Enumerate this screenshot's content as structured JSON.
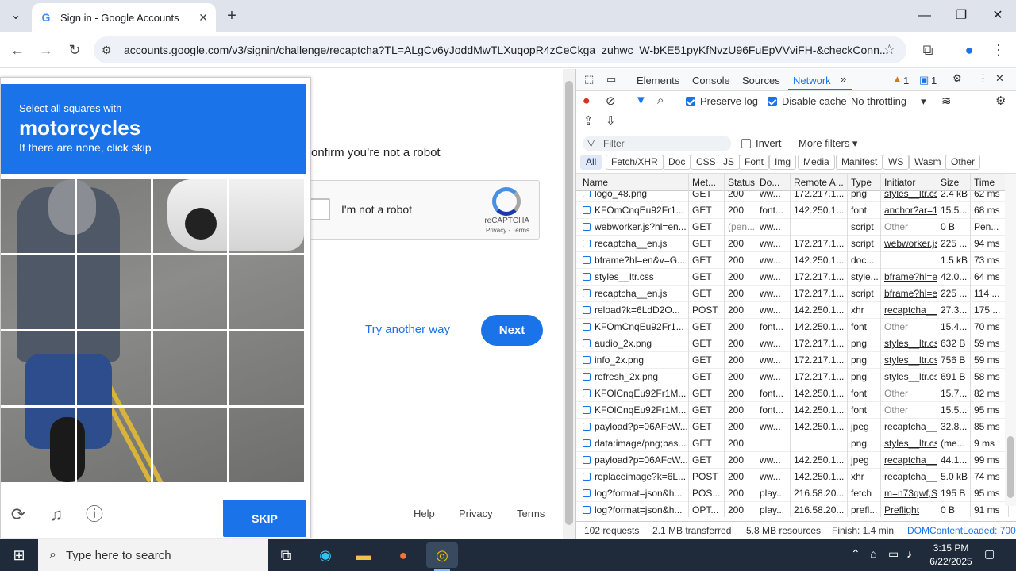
{
  "browser": {
    "tab_title": "Sign in - Google Accounts",
    "tab_favicon": "G",
    "url": "accounts.google.com/v3/signin/challenge/recaptcha?TL=ALgCv6yJoddMwTLXuqopR4zCeCkga_zuhwc_W-bKE51pyKfNvzU96FuEpVVviFH-&checkConn..."
  },
  "captcha": {
    "instruction": "Select all squares with",
    "target": "motorcycles",
    "hint": "If there are none, click skip",
    "skip_label": "SKIP",
    "footer_icons": [
      "reload-icon",
      "audio-icon",
      "info-icon"
    ]
  },
  "signin": {
    "robot_text": "onfirm you’re not a robot",
    "checkbox_label": "I'm not a robot",
    "recaptcha_brand": "reCAPTCHA",
    "privacy_terms": "Privacy - Terms",
    "try_another": "Try another way",
    "next": "Next",
    "footer": {
      "help": "Help",
      "privacy": "Privacy",
      "terms": "Terms"
    }
  },
  "devtools": {
    "tabs": [
      "Elements",
      "Console",
      "Sources",
      "Network"
    ],
    "active_tab": "Network",
    "warnings": "1",
    "messages": "1",
    "preserve_log": "Preserve log",
    "disable_cache": "Disable cache",
    "throttling": "No throttling",
    "filter_placeholder": "Filter",
    "invert": "Invert",
    "more_filters": "More filters",
    "chips": [
      "All",
      "Fetch/XHR",
      "Doc",
      "CSS",
      "JS",
      "Font",
      "Img",
      "Media",
      "Manifest",
      "WS",
      "Wasm",
      "Other"
    ],
    "columns": [
      "Name",
      "Met...",
      "Status",
      "Do...",
      "Remote A...",
      "Type",
      "Initiator",
      "Size",
      "Time"
    ],
    "rows": [
      [
        "logo_48.png",
        "GET",
        "200",
        "ww...",
        "172.217.1...",
        "png",
        "styles__ltr.css",
        "2.4 kB",
        "62 ms"
      ],
      [
        "KFOmCnqEu92Fr1...",
        "GET",
        "200",
        "font...",
        "142.250.1...",
        "font",
        "anchor?ar=1",
        "15.5...",
        "68 ms"
      ],
      [
        "webworker.js?hl=en...",
        "GET",
        "(pen...",
        "ww...",
        "",
        "script",
        "Other",
        "0 B",
        "Pen..."
      ],
      [
        "recaptcha__en.js",
        "GET",
        "200",
        "ww...",
        "172.217.1...",
        "script",
        "webworker.js",
        "225 ...",
        "94 ms"
      ],
      [
        "bframe?hl=en&v=G...",
        "GET",
        "200",
        "ww...",
        "142.250.1...",
        "doc...",
        "",
        "1.5 kB",
        "73 ms"
      ],
      [
        "styles__ltr.css",
        "GET",
        "200",
        "ww...",
        "172.217.1...",
        "style...",
        "bframe?hl=e",
        "42.0...",
        "64 ms"
      ],
      [
        "recaptcha__en.js",
        "GET",
        "200",
        "ww...",
        "172.217.1...",
        "script",
        "bframe?hl=e",
        "225 ...",
        "114 ..."
      ],
      [
        "reload?k=6LdD2O...",
        "POST",
        "200",
        "ww...",
        "142.250.1...",
        "xhr",
        "recaptcha__e",
        "27.3...",
        "175 ..."
      ],
      [
        "KFOmCnqEu92Fr1...",
        "GET",
        "200",
        "font...",
        "142.250.1...",
        "font",
        "Other",
        "15.4...",
        "70 ms"
      ],
      [
        "audio_2x.png",
        "GET",
        "200",
        "ww...",
        "172.217.1...",
        "png",
        "styles__ltr.css",
        "632 B",
        "59 ms"
      ],
      [
        "info_2x.png",
        "GET",
        "200",
        "ww...",
        "172.217.1...",
        "png",
        "styles__ltr.css",
        "756 B",
        "59 ms"
      ],
      [
        "refresh_2x.png",
        "GET",
        "200",
        "ww...",
        "172.217.1...",
        "png",
        "styles__ltr.css",
        "691 B",
        "58 ms"
      ],
      [
        "KFOlCnqEu92Fr1M...",
        "GET",
        "200",
        "font...",
        "142.250.1...",
        "font",
        "Other",
        "15.7...",
        "82 ms"
      ],
      [
        "KFOlCnqEu92Fr1M...",
        "GET",
        "200",
        "font...",
        "142.250.1...",
        "font",
        "Other",
        "15.5...",
        "95 ms"
      ],
      [
        "payload?p=06AFcW...",
        "GET",
        "200",
        "ww...",
        "142.250.1...",
        "jpeg",
        "recaptcha__e",
        "32.8...",
        "85 ms"
      ],
      [
        "data:image/png;bas...",
        "GET",
        "200",
        "",
        "",
        "png",
        "styles__ltr.css",
        "(me...",
        "9 ms"
      ],
      [
        "payload?p=06AFcW...",
        "GET",
        "200",
        "ww...",
        "142.250.1...",
        "jpeg",
        "recaptcha__e",
        "44.1...",
        "99 ms"
      ],
      [
        "replaceimage?k=6L...",
        "POST",
        "200",
        "ww...",
        "142.250.1...",
        "xhr",
        "recaptcha__e",
        "5.0 kB",
        "74 ms"
      ],
      [
        "log?format=json&h...",
        "POS...",
        "200",
        "play...",
        "216.58.20...",
        "fetch",
        "m=n73qwf,S",
        "195 B",
        "95 ms"
      ],
      [
        "log?format=json&h...",
        "OPT...",
        "200",
        "play...",
        "216.58.20...",
        "prefl...",
        "Preflight",
        "0 B",
        "91 ms"
      ]
    ],
    "status": {
      "requests": "102 requests",
      "transferred": "2.1 MB transferred",
      "resources": "5.8 MB resources",
      "finish": "Finish: 1.4 min",
      "dcl": "DOMContentLoaded: 700"
    }
  },
  "taskbar": {
    "search_placeholder": "Type here to search",
    "time": "3:15 PM",
    "date": "6/22/2025"
  }
}
